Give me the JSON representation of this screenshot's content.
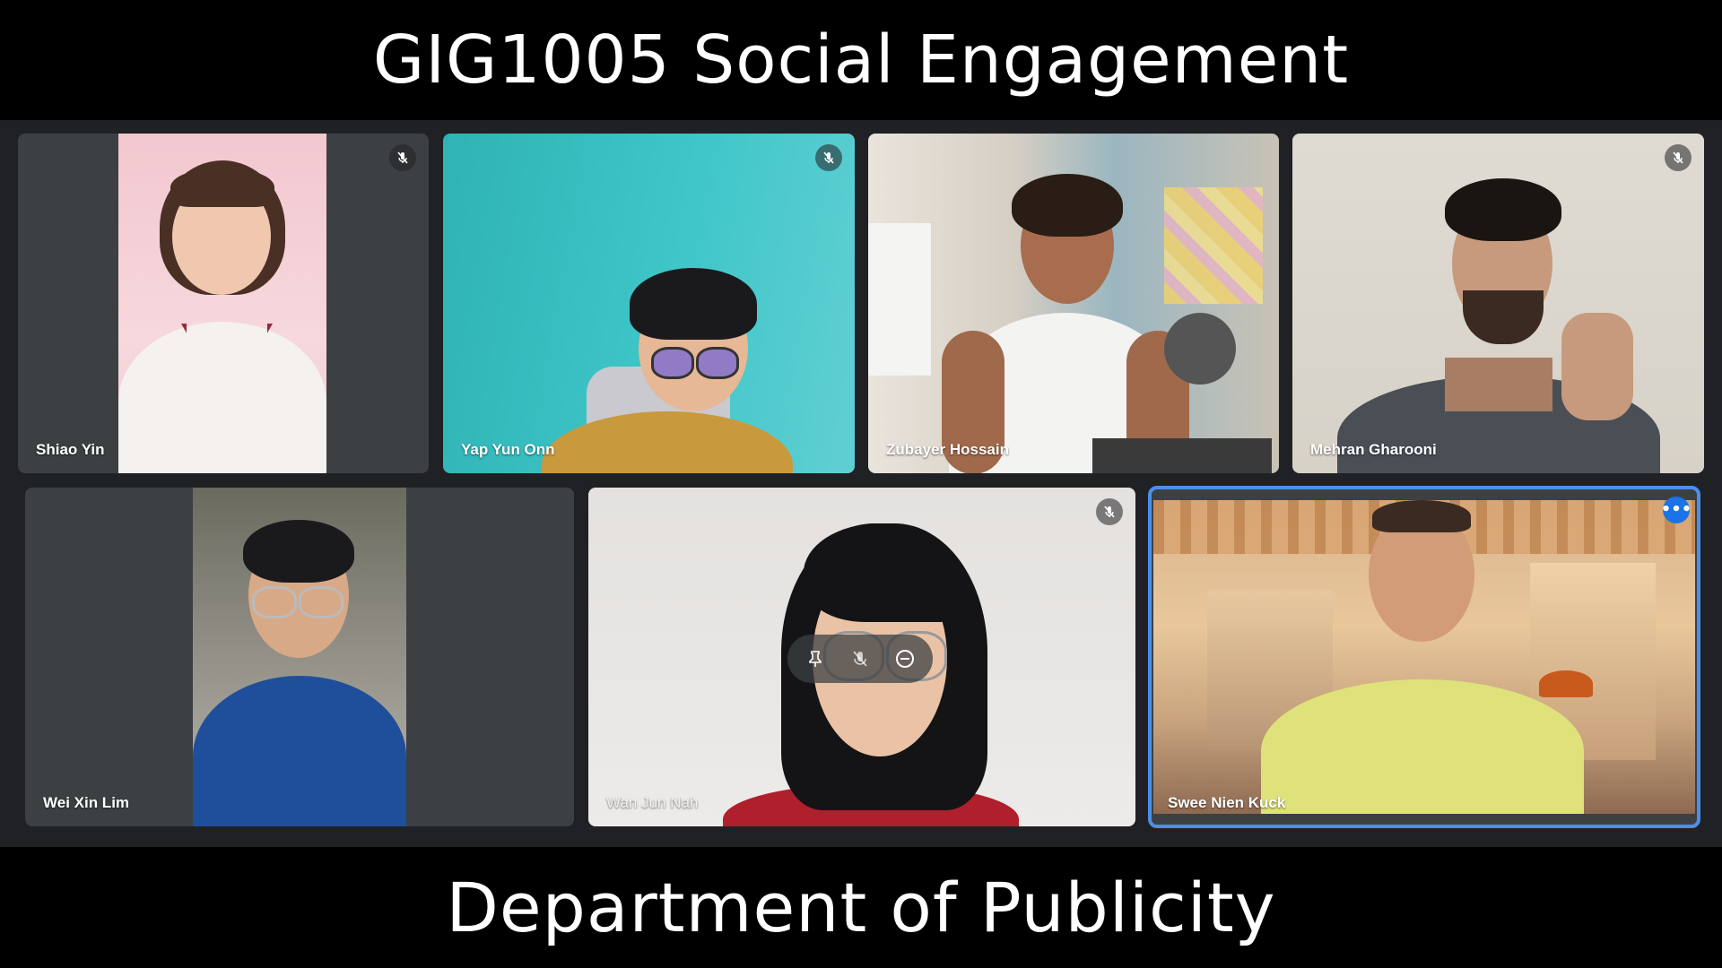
{
  "overlay": {
    "title": "GIG1005 Social Engagement",
    "subtitle": "Department of Publicity"
  },
  "participants": [
    {
      "name": "Shiao Yin",
      "muted": true
    },
    {
      "name": "Yap Yun Onn",
      "muted": true
    },
    {
      "name": "Zubayer Hossain",
      "muted": false
    },
    {
      "name": "Mehran Gharooni",
      "muted": true
    },
    {
      "name": "Wei Xin Lim",
      "muted": false
    },
    {
      "name": "Wan Jun Nah",
      "muted": true
    },
    {
      "name": "Swee Nien Kuck",
      "muted": false,
      "active": true
    }
  ],
  "colors": {
    "stage_background": "#202124",
    "tile_background": "#3c4043",
    "active_outline": "#4a90e8",
    "more_button": "#1a73e8"
  },
  "icons": {
    "muted": "mic-off-icon",
    "more": "more-options-icon",
    "pin": "pin-icon",
    "remove": "remove-icon"
  }
}
